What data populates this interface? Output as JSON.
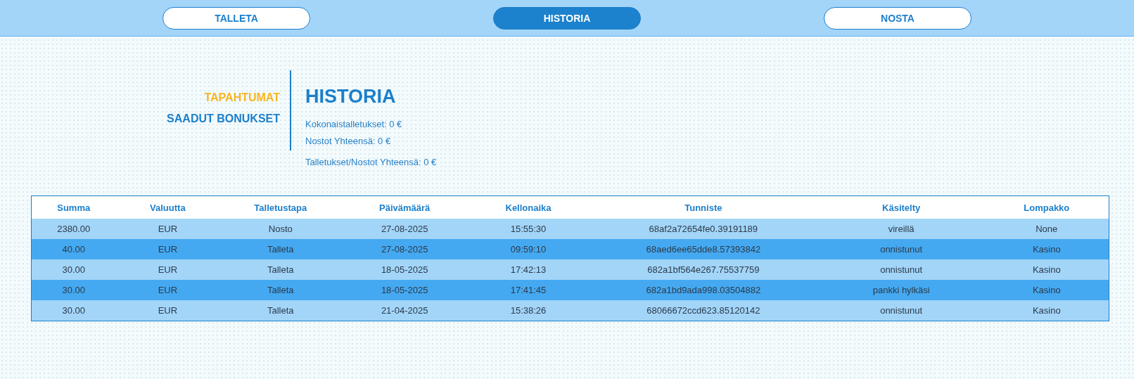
{
  "tabs": [
    {
      "label": "TALLETA",
      "selected": false
    },
    {
      "label": "HISTORIA",
      "selected": true
    },
    {
      "label": "NOSTA",
      "selected": false
    }
  ],
  "menu": [
    {
      "label": "TAPAHTUMAT",
      "selected": true
    },
    {
      "label": "SAADUT BONUKSET",
      "selected": false
    }
  ],
  "summary": {
    "title": "HISTORIA",
    "lines": [
      "Kokonaistalletukset: 0 €",
      "Nostot Yhteensä: 0 €"
    ],
    "total": "Talletukset/Nostot Yhteensä: 0 €"
  },
  "table": {
    "columns": [
      "Summa",
      "Valuutta",
      "Talletustapa",
      "Päivämäärä",
      "Kellonaika",
      "Tunniste",
      "Käsitelty",
      "Lompakko"
    ],
    "rows": [
      [
        "2380.00",
        "EUR",
        "Nosto",
        "27-08-2025",
        "15:55:30",
        "68af2a72654fe0.39191189",
        "vireillä",
        "None"
      ],
      [
        "40.00",
        "EUR",
        "Talleta",
        "27-08-2025",
        "09:59:10",
        "68aed6ee65dde8.57393842",
        "onnistunut",
        "Kasino"
      ],
      [
        "30.00",
        "EUR",
        "Talleta",
        "18-05-2025",
        "17:42:13",
        "682a1bf564e267.75537759",
        "onnistunut",
        "Kasino"
      ],
      [
        "30.00",
        "EUR",
        "Talleta",
        "18-05-2025",
        "17:41:45",
        "682a1bd9ada998.03504882",
        "pankki hylkäsi",
        "Kasino"
      ],
      [
        "30.00",
        "EUR",
        "Talleta",
        "21-04-2025",
        "15:38:26",
        "68066672ccd623.85120142",
        "onnistunut",
        "Kasino"
      ]
    ]
  }
}
